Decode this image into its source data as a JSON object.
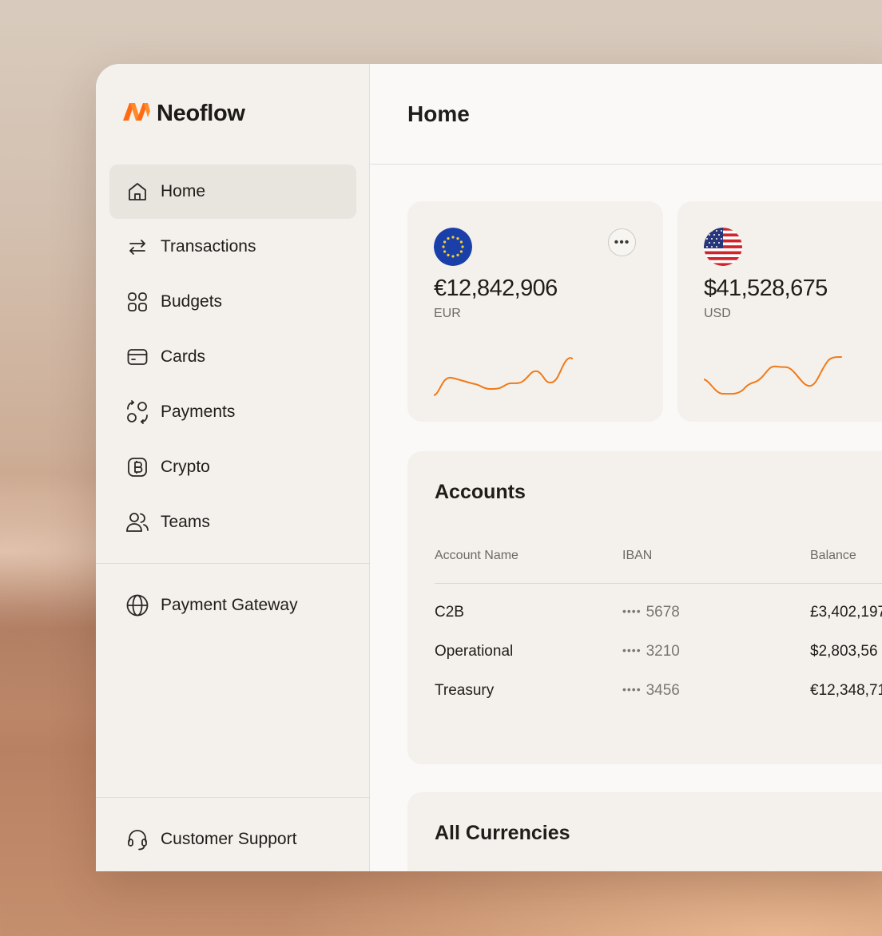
{
  "brand": {
    "name": "Neoflow",
    "accent": "#ff6a13"
  },
  "sidebar": {
    "items": [
      {
        "label": "Home",
        "icon": "home-icon",
        "active": true
      },
      {
        "label": "Transactions",
        "icon": "arrows-swap-icon"
      },
      {
        "label": "Budgets",
        "icon": "grid-icon"
      },
      {
        "label": "Cards",
        "icon": "card-icon"
      },
      {
        "label": "Payments",
        "icon": "payments-cycle-icon"
      },
      {
        "label": "Crypto",
        "icon": "bitcoin-icon"
      },
      {
        "label": "Teams",
        "icon": "users-icon"
      }
    ],
    "extra": {
      "label": "Payment Gateway",
      "icon": "globe-icon"
    },
    "support": {
      "label": "Customer Support",
      "icon": "headset-icon"
    }
  },
  "header": {
    "title": "Home"
  },
  "balances": [
    {
      "amount": "€12,842,906",
      "code": "EUR",
      "flag": "eu-flag-icon",
      "sparkline_color": "#f07a1a"
    },
    {
      "amount": "$41,528,675",
      "code": "USD",
      "flag": "us-flag-icon",
      "sparkline_color": "#f07a1a"
    }
  ],
  "accounts": {
    "title": "Accounts",
    "columns": [
      "Account Name",
      "IBAN",
      "Balance"
    ],
    "rows": [
      {
        "name": "C2B",
        "iban_dots": "••••",
        "iban_last": "5678",
        "balance": "£3,402,197"
      },
      {
        "name": "Operational",
        "iban_dots": "••••",
        "iban_last": "3210",
        "balance": "$2,803,56"
      },
      {
        "name": "Treasury",
        "iban_dots": "••••",
        "iban_last": "3456",
        "balance": "€12,348,71"
      }
    ]
  },
  "currencies": {
    "title": "All Currencies"
  }
}
